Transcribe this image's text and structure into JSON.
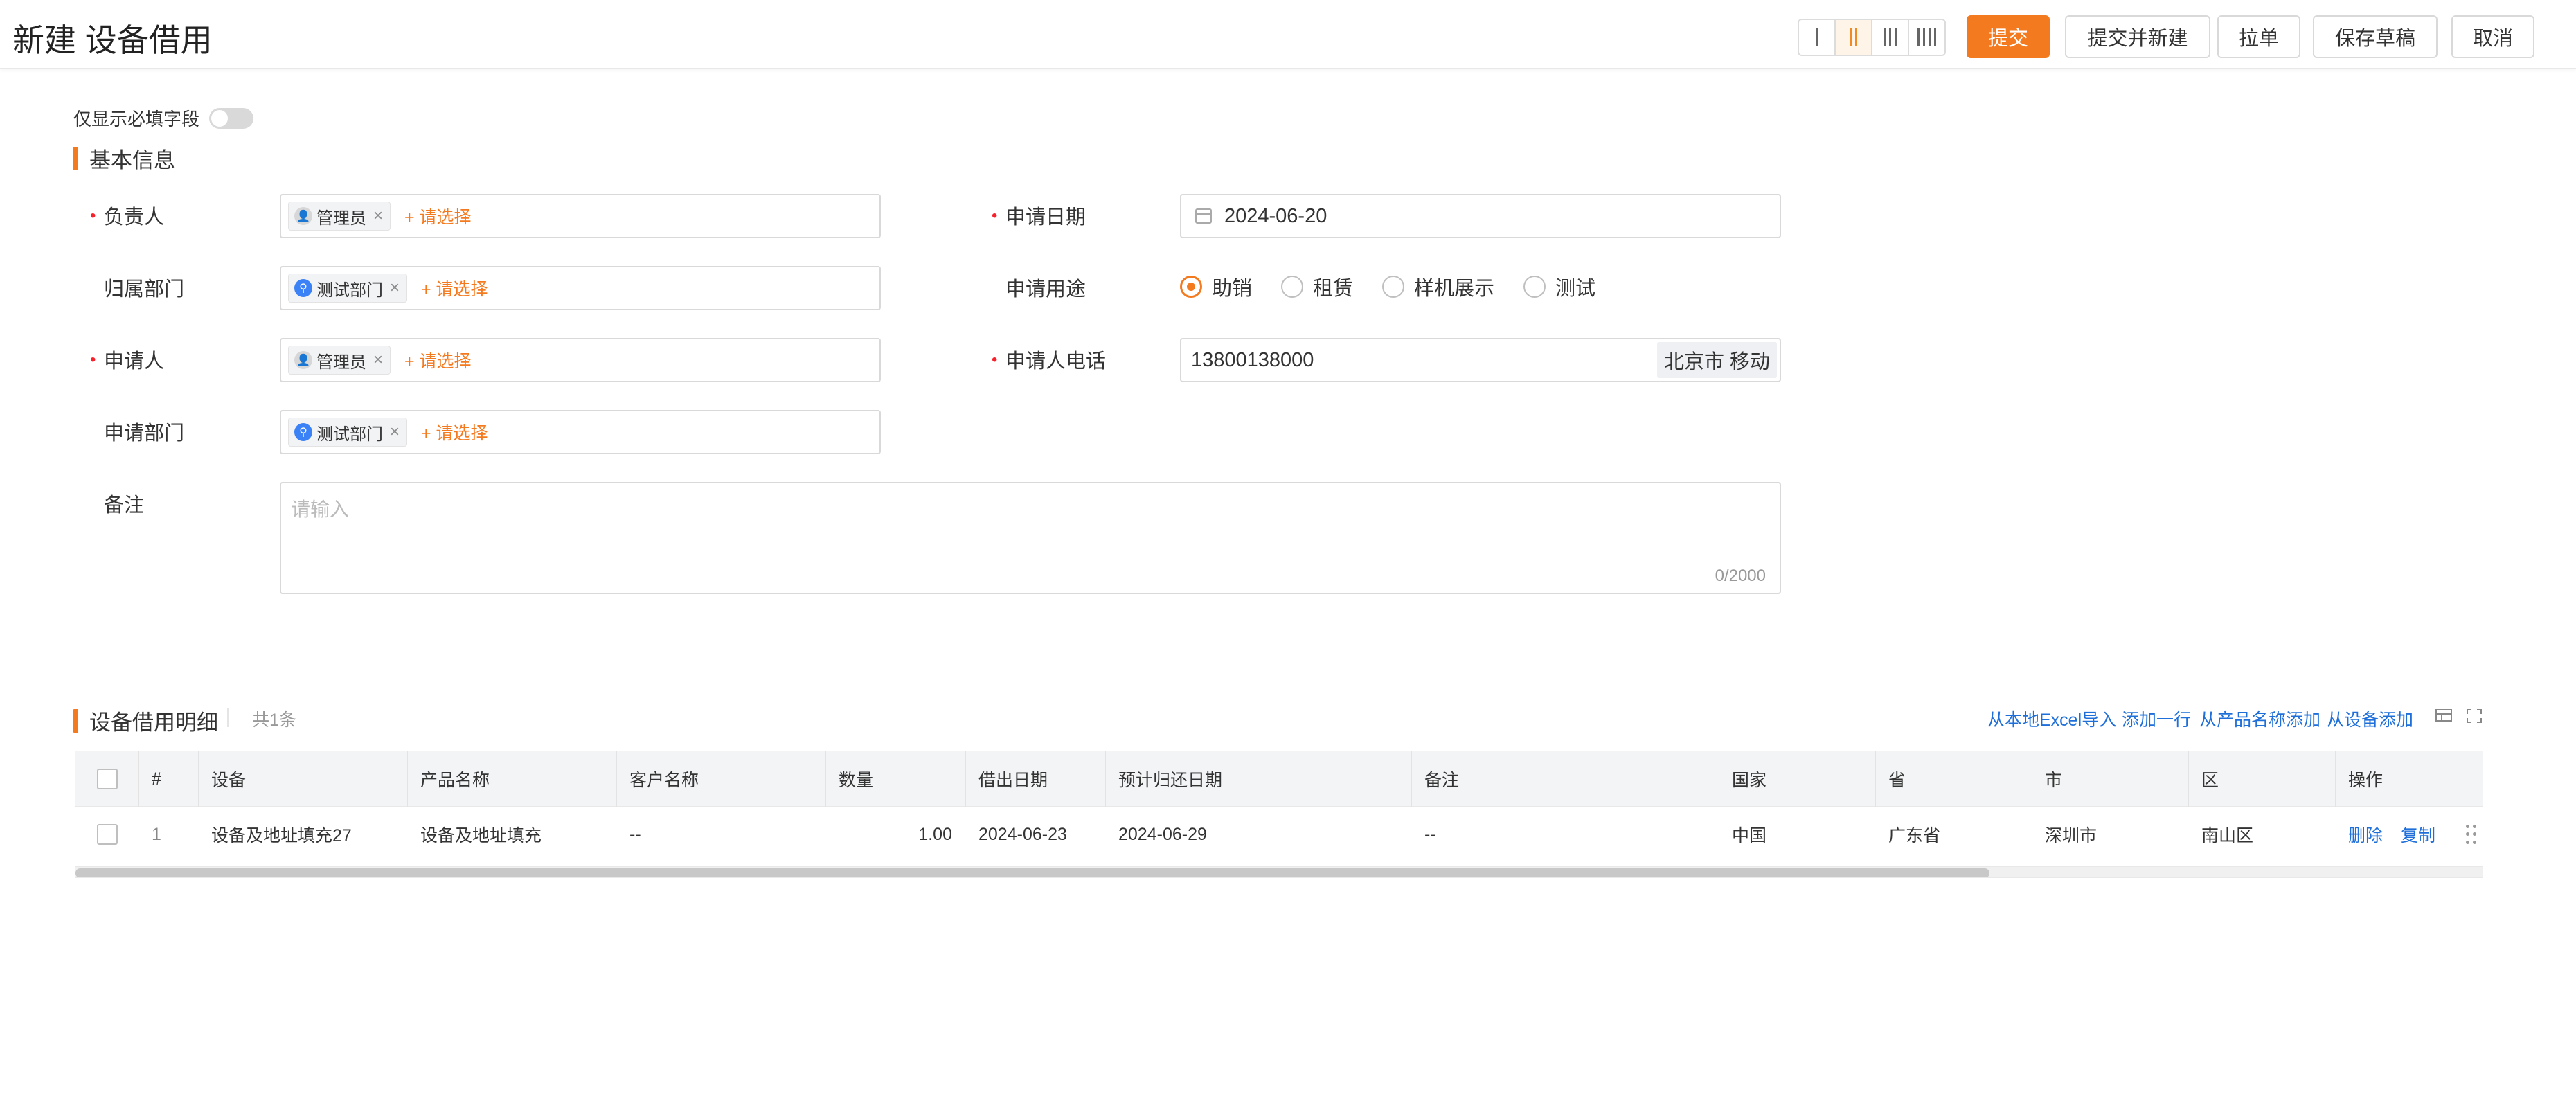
{
  "header": {
    "title": "新建 设备借用",
    "layout_options": [
      "1",
      "2",
      "3",
      "4"
    ],
    "layout_selected": "2",
    "buttons": {
      "submit": "提交",
      "submit_new": "提交并新建",
      "pull": "拉单",
      "save_draft": "保存草稿",
      "cancel": "取消"
    }
  },
  "form": {
    "required_only_label": "仅显示必填字段",
    "section_basic": "基本信息",
    "owner": {
      "label": "负责人",
      "tag": "管理员",
      "add": "+ 请选择"
    },
    "owner_dept": {
      "label": "归属部门",
      "tag": "测试部门",
      "add": "+ 请选择"
    },
    "applicant": {
      "label": "申请人",
      "tag": "管理员",
      "add": "+ 请选择"
    },
    "applicant_dept": {
      "label": "申请部门",
      "tag": "测试部门",
      "add": "+ 请选择"
    },
    "apply_date": {
      "label": "申请日期",
      "value": "2024-06-20"
    },
    "purpose": {
      "label": "申请用途",
      "options": [
        "助销",
        "租赁",
        "样机展示",
        "测试"
      ],
      "selected": "助销"
    },
    "phone": {
      "label": "申请人电话",
      "value": "13800138000",
      "carrier": "北京市 移动"
    },
    "remark": {
      "label": "备注",
      "placeholder": "请输入",
      "count": "0/2000"
    }
  },
  "detail": {
    "title": "设备借用明细",
    "count": "共1条",
    "links": {
      "import_excel": "从本地Excel导入",
      "add_row": "添加一行",
      "add_by_product": "从产品名称添加",
      "add_by_device": "从设备添加"
    },
    "columns": [
      "#",
      "设备",
      "产品名称",
      "客户名称",
      "数量",
      "借出日期",
      "预计归还日期",
      "备注",
      "国家",
      "省",
      "市",
      "区",
      "操作"
    ],
    "rows": [
      {
        "index": "1",
        "device": "设备及地址填充27",
        "product": "设备及地址填充",
        "customer": "--",
        "qty": "1.00",
        "lend_date": "2024-06-23",
        "return_date": "2024-06-29",
        "remark": "--",
        "country": "中国",
        "province": "广东省",
        "city": "深圳市",
        "district": "南山区",
        "ops": {
          "delete": "删除",
          "copy": "复制"
        }
      }
    ]
  },
  "colors": {
    "accent": "#f47a1f",
    "link": "#1e6fd9",
    "required": "#f5222d"
  }
}
